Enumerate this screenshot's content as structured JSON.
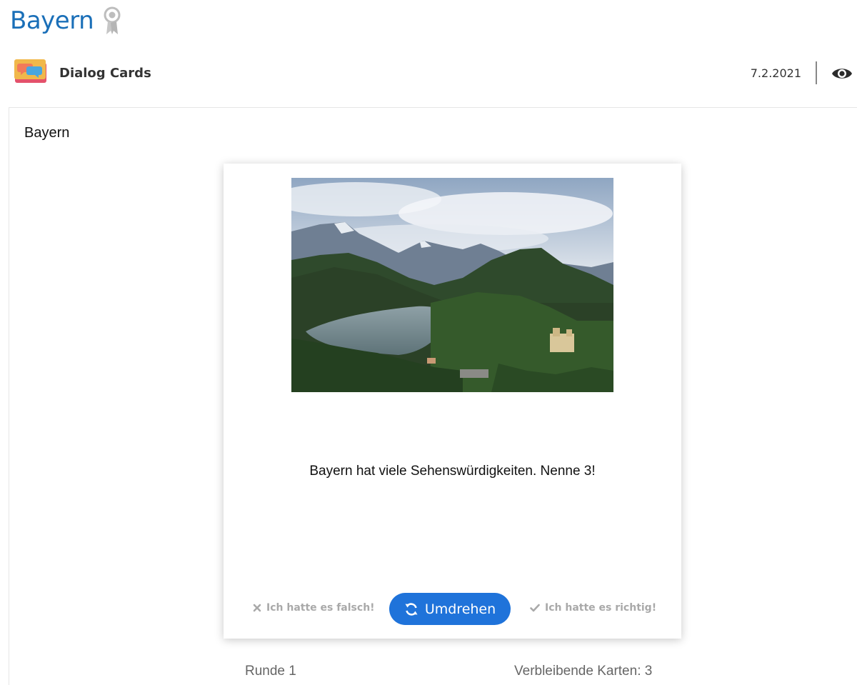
{
  "header": {
    "title": "Bayern",
    "title_color": "#1a6fb8",
    "title_icon": "award-ribbon-icon"
  },
  "meta": {
    "content_type": "Dialog Cards",
    "content_type_icon": "dialog-cards-icon",
    "date": "7.2.2021",
    "view_icon": "eye-icon"
  },
  "content": {
    "title": "Bayern"
  },
  "card": {
    "image_subject": "mountain-lake-landscape-image",
    "text": "Bayern hat viele Sehenswürdigkeiten. Nenne 3!",
    "wrong_label": "Ich hatte es falsch!",
    "flip_label": "Umdrehen",
    "right_label": "Ich hatte es richtig!",
    "flip_color": "#1f73da"
  },
  "footer": {
    "round": "Runde 1",
    "remaining": "Verbleibende Karten: 3"
  }
}
